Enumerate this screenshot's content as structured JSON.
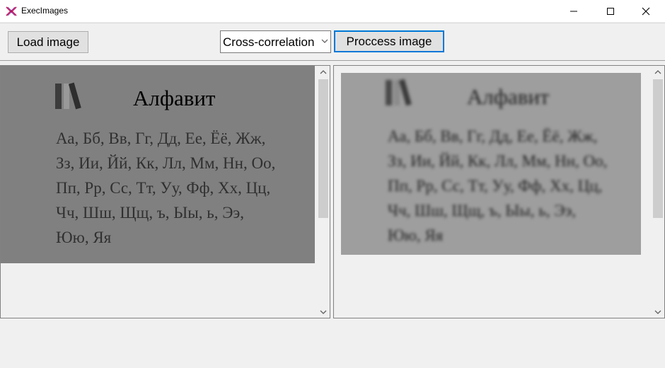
{
  "window": {
    "title": "ExecImages",
    "icons": {
      "app": "app-logo-icon",
      "minimize": "minimize-icon",
      "maximize": "maximize-icon",
      "close": "close-icon"
    }
  },
  "toolbar": {
    "load_label": "Load image",
    "method": {
      "selected": "Cross-correlation"
    },
    "process_label": "Proccess image"
  },
  "original_image": {
    "title": "Алфавит",
    "lines": [
      "Аа, Бб, Вв, Гг, Дд, Ее, Ёё, Жж,",
      "Зз, Ии, Йй, Кк, Лл, Мм, Нн, Оо,",
      "Пп, Рр, Сс, Тт, Уу, Фф, Хх, Цц,",
      "Чч, Шш, Щщ, ъ, Ыы, ь, Ээ,",
      "Юю, Яя"
    ],
    "icon": "books-icon"
  },
  "processed_image": {
    "title": "Алфавит",
    "lines": [
      "Аа, Бб, Вв, Гг, Дд, Ее, Ёё, Жж,",
      "Зз, Ии, Йй, Кк, Лл, Мм, Нн, Оо,",
      "Пп, Рр, Сс, Тт, Уу, Фф, Хх, Цц,",
      "Чч, Шш, Щщ, ъ, Ыы, ь, Ээ,",
      "Юю, Яя"
    ],
    "icon": "books-icon"
  },
  "colors": {
    "original_bg": "#808080",
    "processed_bg": "#9e9e9e",
    "focus_accent": "#0078d7"
  }
}
